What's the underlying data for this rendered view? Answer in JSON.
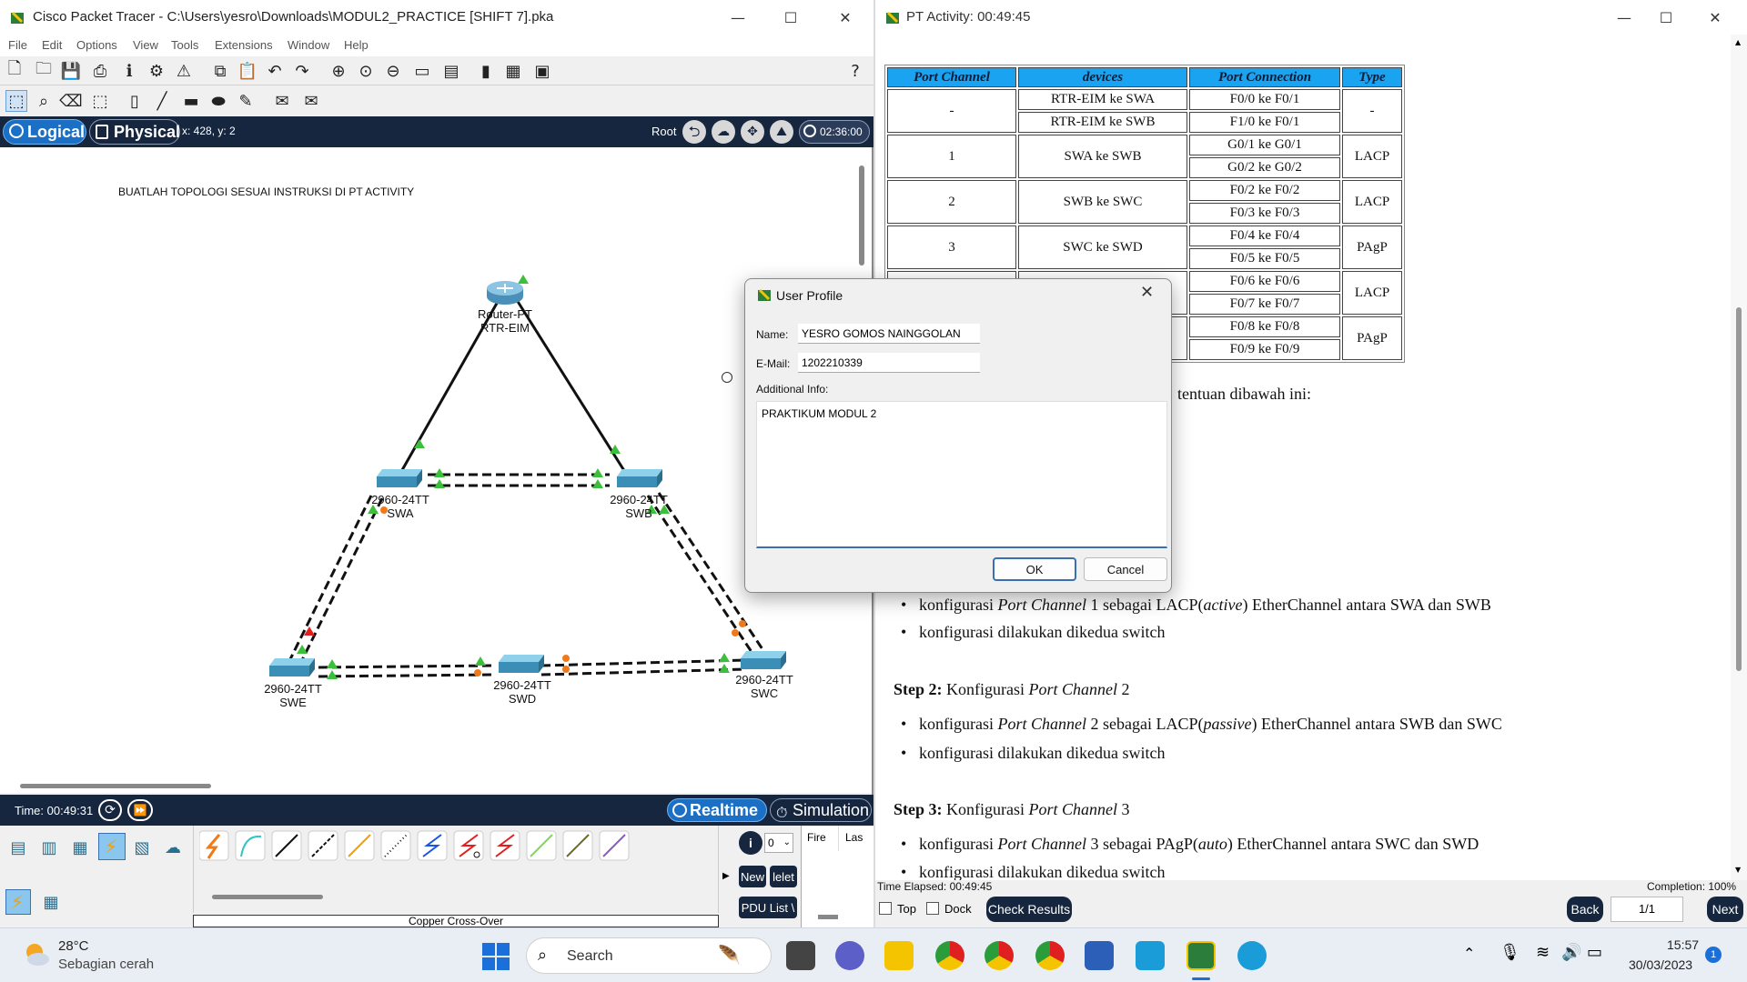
{
  "pt_window": {
    "title": "Cisco Packet Tracer - C:\\Users\\yesro\\Downloads\\MODUL2_PRACTICE [SHIFT 7].pka",
    "menu": [
      "File",
      "Edit",
      "Options",
      "View",
      "Tools",
      "Extensions",
      "Window",
      "Help"
    ],
    "tabs": {
      "logical": "Logical",
      "physical": "Physical"
    },
    "coords": "x: 428, y: 2",
    "root_label": "Root",
    "clock": "02:36:00",
    "canvas_note": "BUATLAH TOPOLOGI SESUAI INSTRUKSI DI PT ACTIVITY",
    "devices": {
      "router": {
        "model": "Router-PT",
        "name": "RTR-EIM"
      },
      "swa": {
        "model": "2960-24TT",
        "name": "SWA"
      },
      "swb": {
        "model": "2960-24TT",
        "name": "SWB"
      },
      "swc": {
        "model": "2960-24TT",
        "name": "SWC"
      },
      "swd": {
        "model": "2960-24TT",
        "name": "SWD"
      },
      "swe": {
        "model": "2960-24TT",
        "name": "SWE"
      }
    },
    "time": "Time: 00:49:31",
    "realtime": "Realtime",
    "simulation": "Simulation",
    "pdu": {
      "counter": "0",
      "fire": "Fire",
      "last": "Las",
      "new": "New",
      "delete": "lelet",
      "pdu_list": "PDU List \\"
    },
    "cable_label": "Copper Cross-Over"
  },
  "activity_window": {
    "title": "PT Activity: 00:49:45",
    "table": {
      "headers": [
        "Port Channel",
        "devices",
        "Port Connection",
        "Type"
      ],
      "groups": [
        {
          "channel": "-",
          "devices": [
            "RTR-EIM ke SWA",
            "RTR-EIM ke SWB"
          ],
          "ports": [
            "F0/0 ke F0/1",
            "F1/0 ke F0/1"
          ],
          "type": "-",
          "single_device": false
        },
        {
          "channel": "1",
          "devices": [
            "SWA ke SWB"
          ],
          "ports": [
            "G0/1 ke G0/1",
            "G0/2 ke G0/2"
          ],
          "type": "LACP",
          "single_device": true
        },
        {
          "channel": "2",
          "devices": [
            "SWB ke SWC"
          ],
          "ports": [
            "F0/2 ke F0/2",
            "F0/3 ke F0/3"
          ],
          "type": "LACP",
          "single_device": true
        },
        {
          "channel": "3",
          "devices": [
            "SWC ke SWD"
          ],
          "ports": [
            "F0/4 ke F0/4",
            "F0/5 ke F0/5"
          ],
          "type": "PAgP",
          "single_device": true
        },
        {
          "channel": "",
          "devices": [
            ""
          ],
          "ports": [
            "F0/6 ke F0/6",
            "F0/7 ke F0/7"
          ],
          "type": "LACP",
          "single_device": true
        },
        {
          "channel": "",
          "devices": [
            ""
          ],
          "ports": [
            "F0/8 ke F0/8",
            "F0/9 ke F0/9"
          ],
          "type": "PAgP",
          "single_device": true
        }
      ]
    },
    "partial_sentence": "tentuan dibawah ini:",
    "step1_bullets": [
      {
        "pre": "konfigurasi ",
        "em": "Port Channel",
        "mid": " 1 sebagai LACP(",
        "em2": "active",
        "post": ") EtherChannel antara SWA dan SWB"
      },
      {
        "pre": "konfigurasi dilakukan dikedua switch",
        "em": "",
        "mid": "",
        "em2": "",
        "post": ""
      }
    ],
    "step2": {
      "bold": "Step 2:",
      "text": " Konfigurasi ",
      "em": "Port Channel",
      "num": " 2"
    },
    "step2_bullets": [
      {
        "pre": "konfigurasi ",
        "em": "Port Channel",
        "mid": " 2 sebagai LACP(",
        "em2": "passive",
        "post": ") EtherChannel antara SWB dan SWC"
      },
      {
        "pre": "konfigurasi dilakukan dikedua switch",
        "em": "",
        "mid": "",
        "em2": "",
        "post": ""
      }
    ],
    "step3": {
      "bold": "Step 3:",
      "text": " Konfigurasi ",
      "em": "Port Channel",
      "num": " 3"
    },
    "step3_bullets": [
      {
        "pre": "konfigurasi ",
        "em": "Port Channel",
        "mid": " 3 sebagai PAgP(",
        "em2": "auto",
        "post": ") EtherChannel antara SWC dan SWD"
      },
      {
        "pre": "konfigurasi dilakukan dikedua switch",
        "em": "",
        "mid": "",
        "em2": "",
        "post": ""
      }
    ],
    "time_elapsed": "Time Elapsed: 00:49:45",
    "completion": "Completion: 100%",
    "top_label": "Top",
    "dock_label": "Dock",
    "check_results": "Check Results",
    "back": "Back",
    "page": "1/1",
    "next": "Next"
  },
  "dialog": {
    "title": "User Profile",
    "name_label": "Name:",
    "name_value": "YESRO GOMOS NAINGGOLAN",
    "email_label": "E-Mail:",
    "email_value": "1202210339",
    "info_label": "Additional Info:",
    "info_value": "PRAKTIKUM MODUL 2",
    "ok": "OK",
    "cancel": "Cancel"
  },
  "taskbar": {
    "weather_temp": "28°C",
    "weather_desc": "Sebagian cerah",
    "search": "Search",
    "time": "15:57",
    "date": "30/03/2023",
    "notification_count": "1"
  },
  "colors": {
    "pt_dark": "#16263f",
    "tab_blue": "#1b6fc4",
    "table_header": "#1aa3f0",
    "link_green": "#3cc03c",
    "link_orange": "#f07a1a",
    "link_red": "#e02020"
  }
}
